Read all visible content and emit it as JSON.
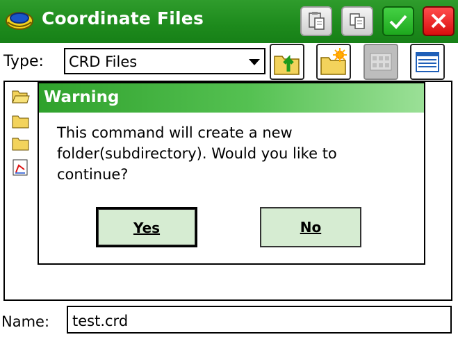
{
  "window": {
    "title": "Coordinate Files",
    "buttons": [
      "paste-icon",
      "copy-icon",
      "checkmark-icon",
      "close-icon"
    ]
  },
  "type_row": {
    "label": "Type:",
    "selected": "CRD Files",
    "tools": [
      "folder-up-icon",
      "new-folder-icon",
      "grid-view-icon",
      "list-view-icon"
    ]
  },
  "dialog": {
    "title": "Warning",
    "message": "This command will create a new folder(subdirectory). Would you like to continue?",
    "yes_label": "Yes",
    "no_label": "No"
  },
  "name_row": {
    "label": "Name:",
    "value": "test.crd"
  },
  "colors": {
    "titlebar": "#1d8a1c",
    "dialog_button": "#d6ecd2",
    "ok": "#2bbd2b",
    "close": "#e31b1b"
  }
}
